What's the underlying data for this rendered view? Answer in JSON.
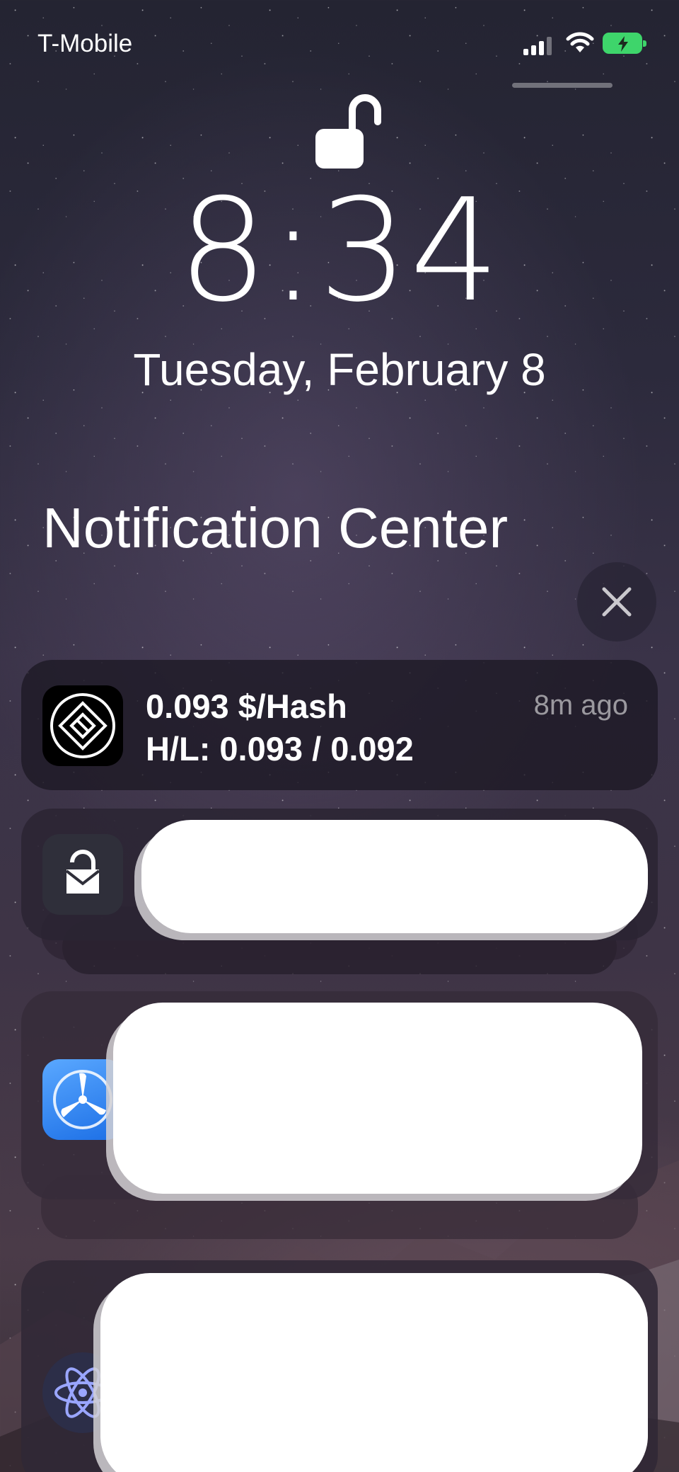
{
  "status_bar": {
    "carrier": "T-Mobile",
    "signal_icon": "signal-bars-icon",
    "wifi_icon": "wifi-icon",
    "battery_icon": "battery-charging-icon",
    "battery_color": "#3ed56b"
  },
  "lock_screen": {
    "lock_icon": "unlocked-padlock-icon",
    "time": "8:34",
    "date": "Tuesday, February 8"
  },
  "notification_center": {
    "title": "Notification Center",
    "close_icon": "close-icon",
    "notifications": [
      {
        "app_icon": "hash-app-icon",
        "line1": "0.093 $/Hash",
        "line2": "H/L: 0.093 / 0.092",
        "time": "8m ago"
      },
      {
        "app_icon": "mail-lock-app-icon",
        "redacted": true
      },
      {
        "app_icon": "fan-app-icon",
        "redacted": true
      },
      {
        "app_icon": "atom-app-icon",
        "redacted": true
      }
    ]
  }
}
